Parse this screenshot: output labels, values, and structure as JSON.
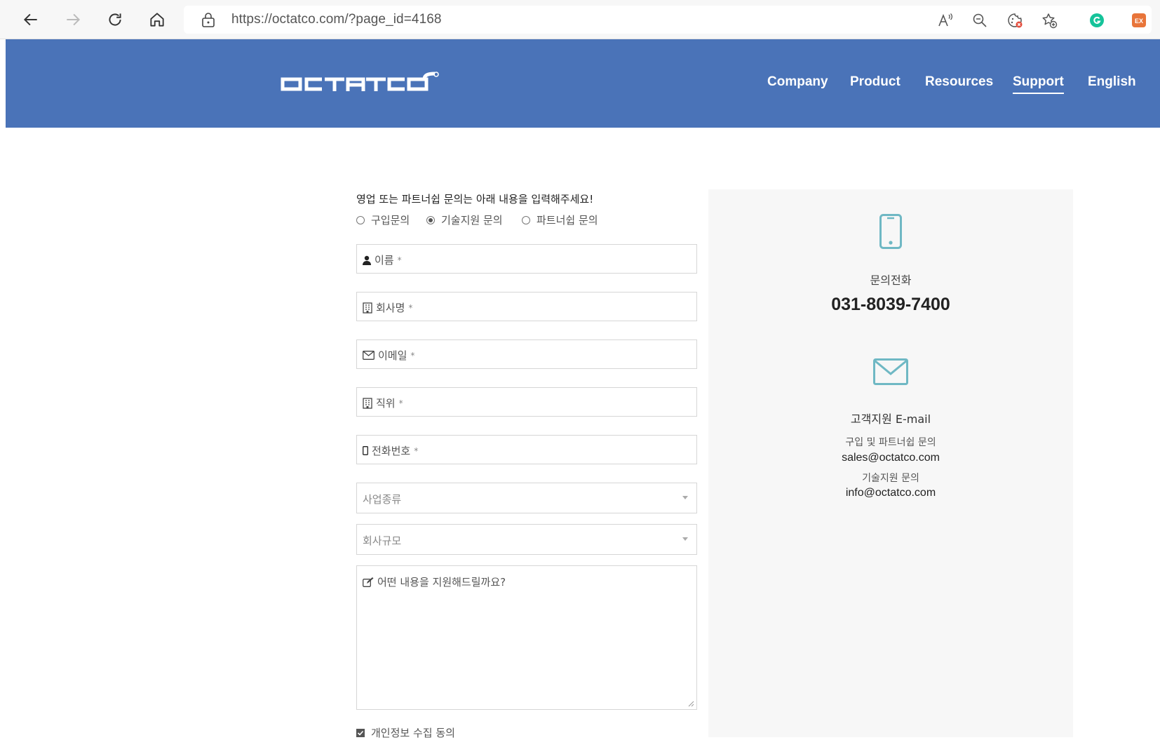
{
  "browser": {
    "url": "https://octatco.com/?page_id=4168",
    "extension_icons": [
      "read-aloud-icon",
      "zoom-out-icon",
      "tracking-prevention-icon",
      "add-favorite-icon",
      "grammarly-icon",
      "extension-ex-icon"
    ]
  },
  "header": {
    "logo_text": "OCTATCO",
    "menu": [
      {
        "label": "Company"
      },
      {
        "label": "Product"
      },
      {
        "label": "Resources"
      },
      {
        "label": "Support",
        "active": true
      },
      {
        "label": "English"
      }
    ],
    "background_color": "#4a73b8"
  },
  "form": {
    "intro": "영업 또는 파트너쉽 문의는 아래 내용을 입력해주세요!",
    "inquiry_types": [
      {
        "label": "구입문의",
        "selected": false
      },
      {
        "label": "기술지원 문의",
        "selected": true
      },
      {
        "label": "파트너쉽 문의",
        "selected": false
      }
    ],
    "fields": {
      "name": "이름",
      "company": "회사명",
      "email": "이메일",
      "position": "직위",
      "phone": "전화번호",
      "required_mark": "*"
    },
    "business_type": "사업종류",
    "company_size": "회사규모",
    "message_placeholder": "어떤 내용을 지원해드릴까요?",
    "consent_label": "개인정보 수집 동의",
    "consent_checked": true
  },
  "contact": {
    "phone_label": "문의전화",
    "phone_number": "031-8039-7400",
    "email_title": "고객지원 E-mail",
    "sales_label": "구입 및 파트너쉽 문의",
    "sales_email": "sales@octatco.com",
    "support_label": "기술지원 문의",
    "support_email": "info@octatco.com",
    "icon_color": "#6fb8c4"
  }
}
